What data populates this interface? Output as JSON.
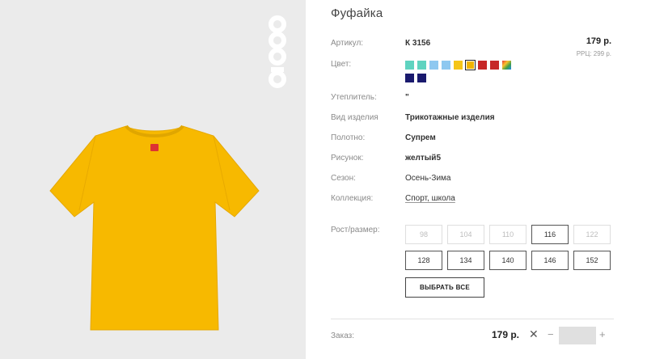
{
  "product": {
    "title": "Фуфайка",
    "price": "179 р.",
    "rrp": "РРЦ: 299 р."
  },
  "attributes": {
    "article": {
      "label": "Артикул:",
      "value": "К 3156"
    },
    "color": {
      "label": "Цвет:"
    },
    "insulation": {
      "label": "Утеплитель:",
      "value": "\""
    },
    "type": {
      "label": "Вид изделия",
      "value": "Трикотажные изделия"
    },
    "fabric": {
      "label": "Полотно:",
      "value": "Супрем"
    },
    "pattern": {
      "label": "Рисунок:",
      "value": "желтый5"
    },
    "season": {
      "label": "Сезон:",
      "value": "Осень-Зима"
    },
    "collection": {
      "label": "Коллекция:",
      "value": "Спорт, школа"
    }
  },
  "colors": {
    "row1": [
      "#5fd3c0",
      "#5fd3c0",
      "#8ec8f0",
      "#8ec8f0",
      "#f5c518",
      "#f0b400",
      "#c62828",
      "#c62828",
      "multicolor"
    ],
    "row2": [
      "#1a1a6e",
      "#1a1a6e"
    ],
    "selected_index": 5
  },
  "sizes": {
    "label": "Рост/размер:",
    "items": [
      {
        "label": "98",
        "enabled": false
      },
      {
        "label": "104",
        "enabled": false
      },
      {
        "label": "110",
        "enabled": false
      },
      {
        "label": "116",
        "enabled": true
      },
      {
        "label": "122",
        "enabled": false
      },
      {
        "label": "128",
        "enabled": true
      },
      {
        "label": "134",
        "enabled": true
      },
      {
        "label": "140",
        "enabled": true
      },
      {
        "label": "146",
        "enabled": true
      },
      {
        "label": "152",
        "enabled": true
      }
    ],
    "select_all": "ВЫБРАТЬ ВСЕ"
  },
  "order": {
    "label": "Заказ:",
    "price": "179 р.",
    "remove": "✕",
    "minus": "−",
    "plus": "+",
    "quantity": ""
  },
  "brand_logo": "acoola",
  "accent_color": "#f5b800"
}
